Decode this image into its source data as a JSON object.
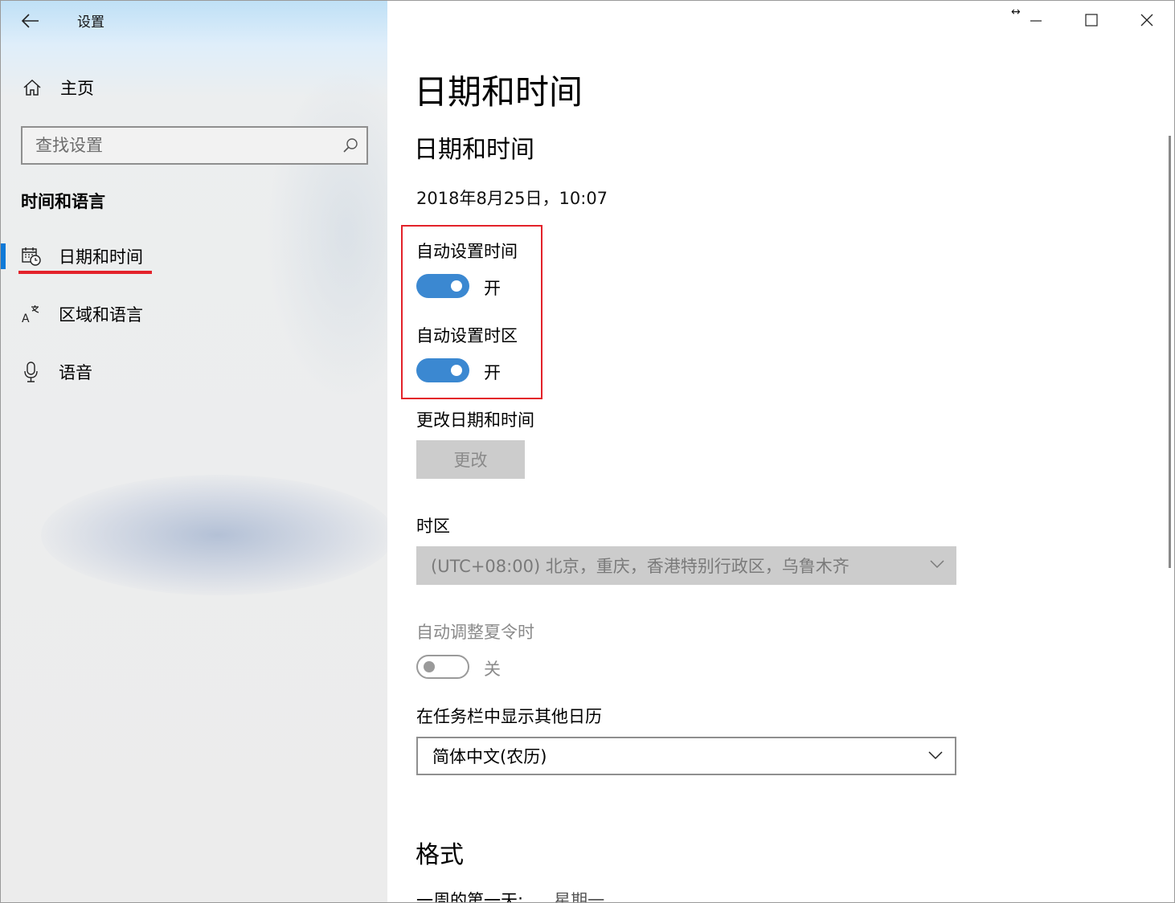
{
  "window": {
    "app_title": "设置"
  },
  "sidebar": {
    "home_label": "主页",
    "search_placeholder": "查找设置",
    "section_title": "时间和语言",
    "items": [
      {
        "label": "日期和时间",
        "icon": "calendar-clock-icon",
        "active": true
      },
      {
        "label": "区域和语言",
        "icon": "language-icon",
        "active": false
      },
      {
        "label": "语音",
        "icon": "microphone-icon",
        "active": false
      }
    ]
  },
  "main": {
    "page_title": "日期和时间",
    "sub_title": "日期和时间",
    "current_datetime": "2018年8月25日，10:07",
    "auto_time": {
      "label": "自动设置时间",
      "state": "开",
      "on": true
    },
    "auto_timezone": {
      "label": "自动设置时区",
      "state": "开",
      "on": true
    },
    "change_datetime": {
      "label": "更改日期和时间",
      "button": "更改"
    },
    "timezone": {
      "label": "时区",
      "value": "(UTC+08:00) 北京，重庆，香港特别行政区，乌鲁木齐"
    },
    "dst": {
      "label": "自动调整夏令时",
      "state": "关",
      "on": false
    },
    "calendar": {
      "label": "在任务栏中显示其他日历",
      "value": "简体中文(农历)"
    },
    "format": {
      "title": "格式",
      "first_day_label": "一周的第一天:",
      "first_day_value": "星期一"
    }
  },
  "colors": {
    "accent": "#3b88d1",
    "highlight": "#e3222a",
    "active_bar": "#0f7ad8"
  }
}
